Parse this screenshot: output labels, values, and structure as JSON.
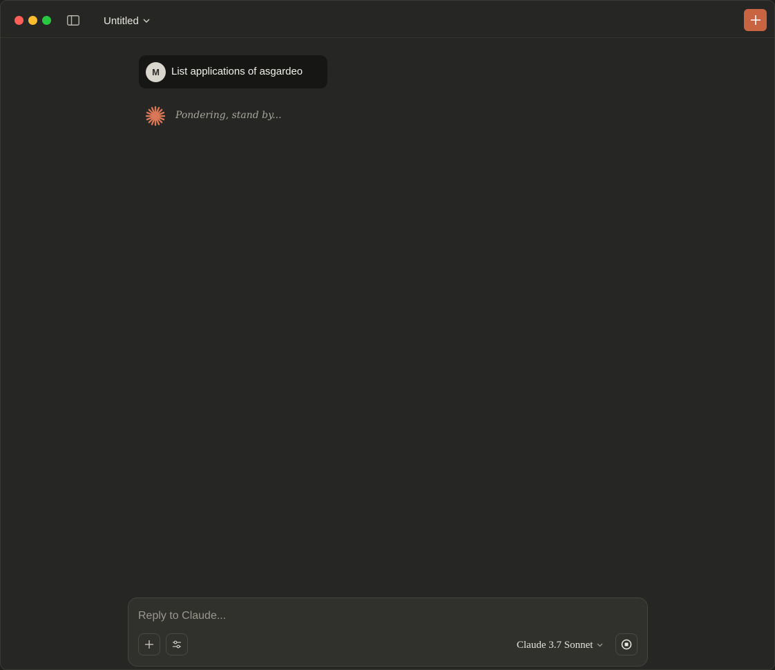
{
  "header": {
    "title": "Untitled",
    "accent_color": "#c96442"
  },
  "conversation": {
    "user_message": {
      "avatar_initial": "M",
      "text": "List applications of asgardeo"
    },
    "assistant_status": "Pondering, stand by..."
  },
  "composer": {
    "placeholder": "Reply to Claude...",
    "model_label": "Claude 3.7 Sonnet"
  },
  "icons": {
    "sidebar_toggle": "sidebar-toggle-icon",
    "new_chat": "plus-icon",
    "attach": "plus-icon",
    "tools": "sliders-icon",
    "stop": "stop-icon",
    "assistant": "spark-icon"
  }
}
